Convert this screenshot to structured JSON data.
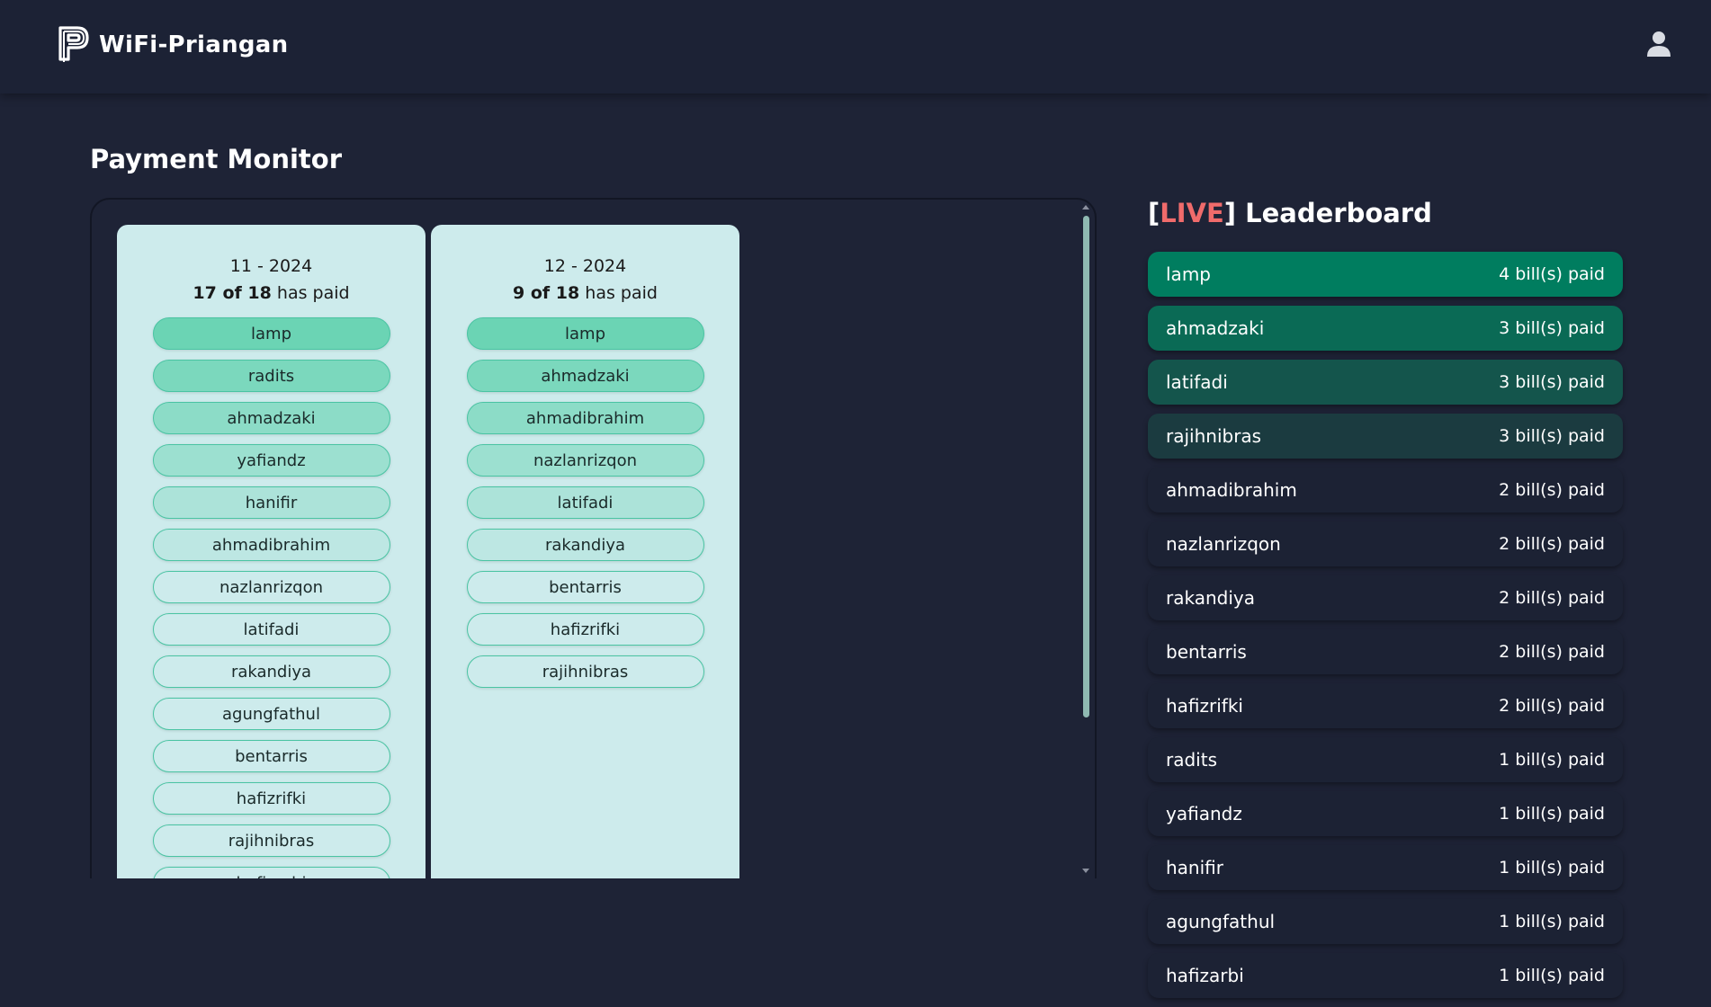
{
  "app": {
    "name": "WiFi-Priangan",
    "logo_icon": "logo-p-icon",
    "user_icon": "user-icon"
  },
  "page": {
    "title": "Payment Monitor"
  },
  "months": [
    {
      "label": "11 - 2024",
      "paid_summary": "17 of 18",
      "paid_suffix": "has paid",
      "payers": [
        "lamp",
        "radits",
        "ahmadzaki",
        "yafiandz",
        "hanifir",
        "ahmadibrahim",
        "nazlanrizqon",
        "latifadi",
        "rakandiya",
        "agungfathul",
        "bentarris",
        "hafizrifki",
        "rajihnibras",
        "hafizarbi"
      ]
    },
    {
      "label": "12 - 2024",
      "paid_summary": "9 of 18",
      "paid_suffix": "has paid",
      "payers": [
        "lamp",
        "ahmadzaki",
        "ahmadibrahim",
        "nazlanrizqon",
        "latifadi",
        "rakandiya",
        "bentarris",
        "hafizrifki",
        "rajihnibras"
      ]
    }
  ],
  "leaderboard": {
    "bracket_open": "[",
    "live": "LIVE",
    "bracket_close": "]",
    "title": " Leaderboard",
    "rows": [
      {
        "name": "lamp",
        "paid": "4 bill(s) paid",
        "color": "#007d5f"
      },
      {
        "name": "ahmadzaki",
        "paid": "3 bill(s) paid",
        "color": "#0a6a55"
      },
      {
        "name": "latifadi",
        "paid": "3 bill(s) paid",
        "color": "#14554c"
      },
      {
        "name": "rajihnibras",
        "paid": "3 bill(s) paid",
        "color": "#1b3b40"
      },
      {
        "name": "ahmadibrahim",
        "paid": "2 bill(s) paid",
        "color": "#1c2234"
      },
      {
        "name": "nazlanrizqon",
        "paid": "2 bill(s) paid",
        "color": "#1c2234"
      },
      {
        "name": "rakandiya",
        "paid": "2 bill(s) paid",
        "color": "#1c2234"
      },
      {
        "name": "bentarris",
        "paid": "2 bill(s) paid",
        "color": "#1c2234"
      },
      {
        "name": "hafizrifki",
        "paid": "2 bill(s) paid",
        "color": "#1c2234"
      },
      {
        "name": "radits",
        "paid": "1 bill(s) paid",
        "color": "#1c2234"
      },
      {
        "name": "yafiandz",
        "paid": "1 bill(s) paid",
        "color": "#1c2234"
      },
      {
        "name": "hanifir",
        "paid": "1 bill(s) paid",
        "color": "#1c2234"
      },
      {
        "name": "agungfathul",
        "paid": "1 bill(s) paid",
        "color": "#1c2234"
      },
      {
        "name": "hafizarbi",
        "paid": "1 bill(s) paid",
        "color": "#1c2234"
      }
    ]
  },
  "colors": {
    "background": "#1e2336",
    "card": "#cdebec",
    "accent": "#4ac4a3",
    "live": "#f06b6b"
  }
}
